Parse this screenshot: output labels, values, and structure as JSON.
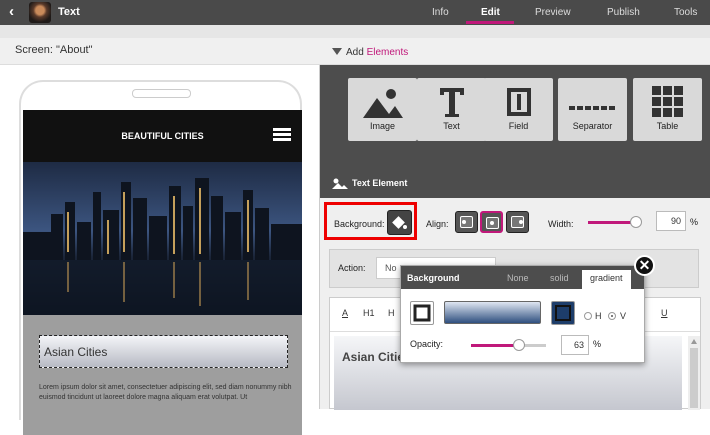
{
  "header": {
    "back_icon": "chevron-left-icon",
    "title": "Text",
    "tabs": [
      {
        "label": "Info",
        "active": false
      },
      {
        "label": "Edit",
        "active": true
      },
      {
        "label": "Preview",
        "active": false
      },
      {
        "label": "Publish",
        "active": false
      },
      {
        "label": "Tools",
        "active": false
      }
    ],
    "accent_color": "#c0187a"
  },
  "screen": {
    "label": "Screen: \"About\""
  },
  "add_elements": {
    "prefix": "Add",
    "highlight": "Elements",
    "items": [
      {
        "label": "Image",
        "icon": "image-icon"
      },
      {
        "label": "Text",
        "icon": "text-icon"
      },
      {
        "label": "Field",
        "icon": "field-icon"
      },
      {
        "label": "Separator",
        "icon": "separator-icon"
      },
      {
        "label": "Table",
        "icon": "table-icon"
      }
    ]
  },
  "phone": {
    "header_title": "BEAUTIFUL CITIES",
    "selected_heading": "Asian Cities",
    "body_text": "Lorem ipsum dolor sit amet, consectetuer adipiscing elit, sed diam nonummy nibh euismod tincidunt ut laoreet dolore magna aliquam erat volutpat. Ut"
  },
  "text_element": {
    "section_title": "Text Element",
    "background_label": "Background:",
    "align_label": "Align:",
    "align_selected": "center",
    "width_label": "Width:",
    "width_value": "90",
    "width_unit": "%",
    "action_label": "Action:",
    "action_value": "No",
    "toolbar": {
      "b1": "A",
      "b2": "H1",
      "b3": "H",
      "b4": "I",
      "b5": "U"
    },
    "editor_text": "Asian Cities"
  },
  "background_popup": {
    "title": "Background",
    "tabs": [
      {
        "label": "None",
        "active": false
      },
      {
        "label": "solid",
        "active": false
      },
      {
        "label": "gradient",
        "active": true
      }
    ],
    "direction_h": "H",
    "direction_v": "V",
    "direction_selected": "V",
    "opacity_label": "Opacity:",
    "opacity_value": "63",
    "opacity_unit": "%",
    "gradient_start": "#dfe6f2",
    "gradient_end": "#2f4f7f",
    "close_icon": "close-icon"
  }
}
